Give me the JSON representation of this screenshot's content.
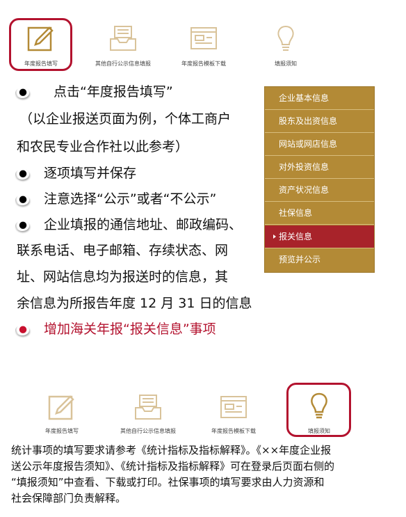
{
  "top_icons": [
    {
      "label": "年度报告填写",
      "icon": "pencil-icon"
    },
    {
      "label": "其他自行公示信息填报",
      "icon": "inbox-tray-icon"
    },
    {
      "label": "年度报告模板下载",
      "icon": "form-template-icon"
    },
    {
      "label": "填报须知",
      "icon": "lightbulb-icon"
    }
  ],
  "bottom_icons": [
    {
      "label": "年度报告填写",
      "icon": "pencil-icon"
    },
    {
      "label": "其他自行公示信息填报",
      "icon": "inbox-tray-icon"
    },
    {
      "label": "年度报告模板下载",
      "icon": "form-template-icon"
    },
    {
      "label": "填报须知",
      "icon": "lightbulb-icon"
    }
  ],
  "instructions": {
    "b1": "点击“年度报告填写”",
    "b1_note_1": "（以企业报送页面为例，个体工商户",
    "b1_note_2": "和农民专业合作社以此参考）",
    "b2": "逐项填写并保存",
    "b3": "注意选择“公示”或者“不公示”",
    "b4_1": "企业填报的通信地址、邮政编码、",
    "b4_2": "联系电话、电子邮箱、存续状态、网",
    "b4_3": "址、网站信息均为报送时的信息，其",
    "b4_4": "余信息为所报告年度 12 月 31 日的信息",
    "b5": "增加海关年报“报关信息”事项"
  },
  "side_menu": {
    "items": [
      "企业基本信息",
      "股东及出资信息",
      "网站或网店信息",
      "对外投资信息",
      "资产状况信息",
      "社保信息",
      "报关信息",
      "预览并公示"
    ],
    "active_index": 6
  },
  "footer": {
    "line1": "统计事项的填写要求请参考《统计指标及指标解释》。《××年度企业报",
    "line2": "送公示年度报告须知》、《统计指标及指标解释》可在登录后页面右侧的",
    "line3": "“填报须知”中查看、下载或打印。社保事项的填写要求由人力资源和",
    "line4": "社会保障部门负责解释。"
  },
  "colors": {
    "accent": "#b38a36",
    "highlight": "#b3122e",
    "active": "#a8232a"
  }
}
